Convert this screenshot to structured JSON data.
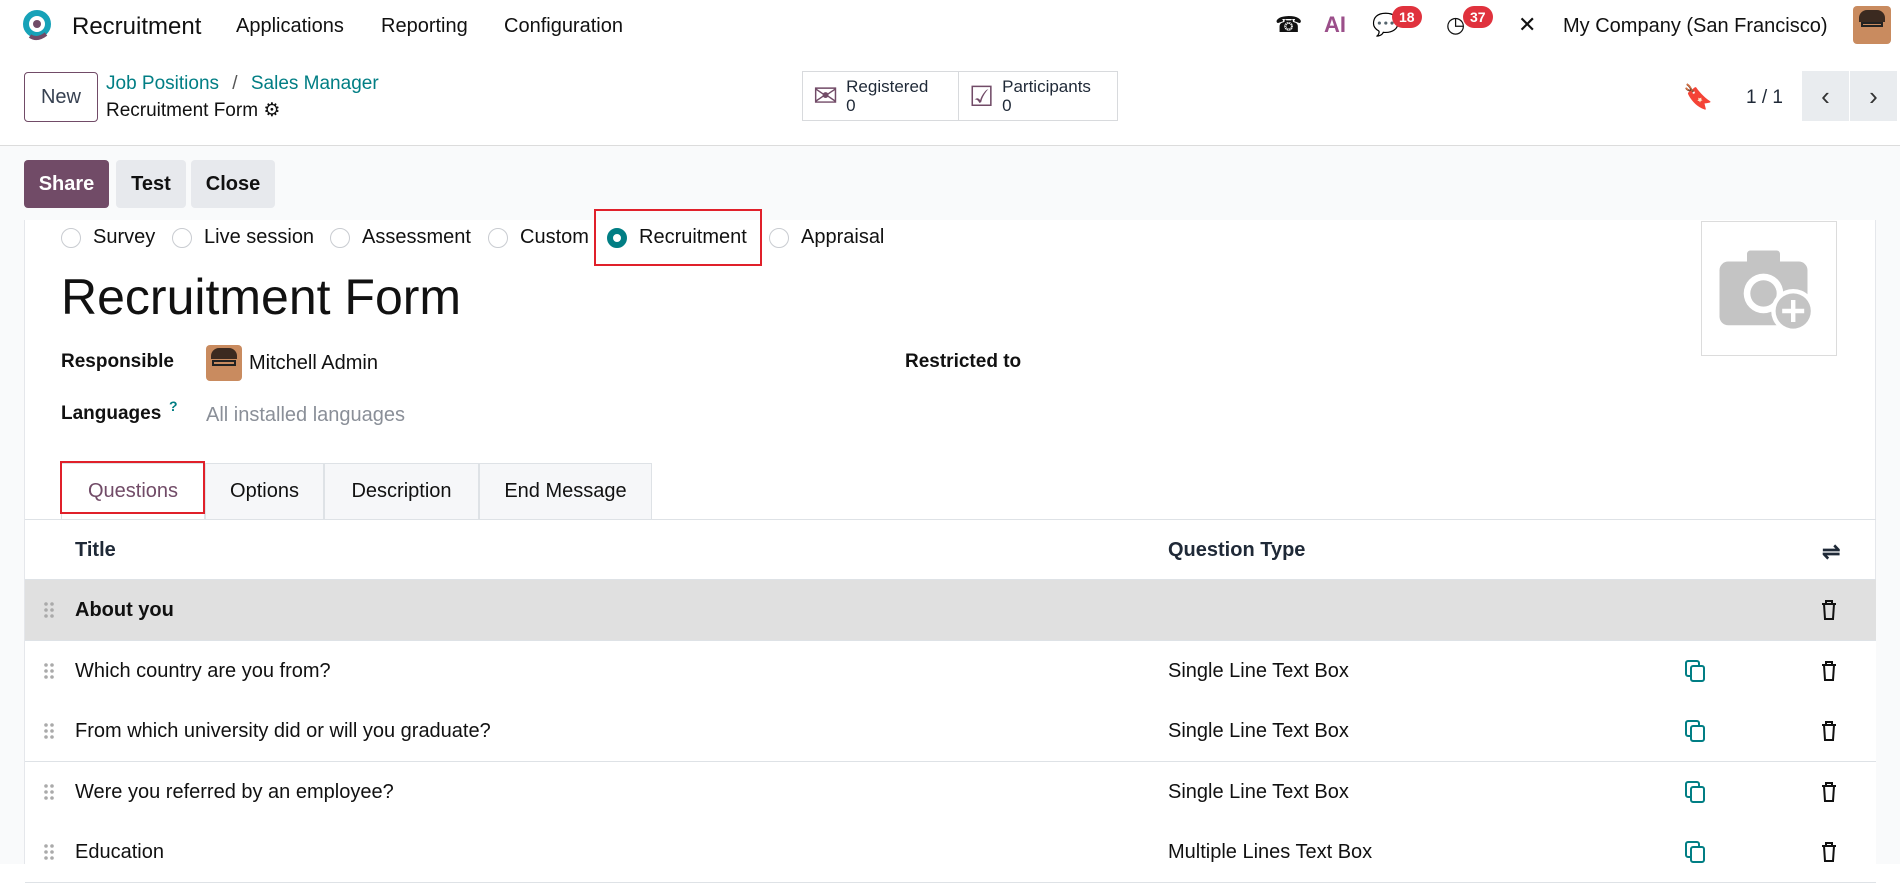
{
  "nav": {
    "app": "Recruitment",
    "menus": [
      "Applications",
      "Reporting",
      "Configuration"
    ],
    "messages_count": "18",
    "activities_count": "37",
    "ai_label": "AI",
    "company": "My Company (San Francisco)"
  },
  "control": {
    "new_label": "New",
    "breadcrumb": [
      "Job Positions",
      "Sales Manager"
    ],
    "separator": "/",
    "record": "Recruitment Form",
    "stats": [
      {
        "label": "Registered",
        "value": "0"
      },
      {
        "label": "Participants",
        "value": "0"
      }
    ],
    "pager": "1 / 1"
  },
  "actions": {
    "share": "Share",
    "test": "Test",
    "close": "Close"
  },
  "form": {
    "survey_types": [
      "Survey",
      "Live session",
      "Assessment",
      "Custom",
      "Recruitment",
      "Appraisal"
    ],
    "selected_type": "Recruitment",
    "title": "Recruitment Form",
    "responsible_label": "Responsible",
    "responsible": "Mitchell Admin",
    "restricted_label": "Restricted to",
    "languages_label": "Languages",
    "languages_help": "?",
    "languages_placeholder": "All installed languages",
    "tabs": [
      "Questions",
      "Options",
      "Description",
      "End Message"
    ],
    "active_tab": "Questions"
  },
  "table": {
    "columns": [
      "Title",
      "Question Type"
    ],
    "rows": [
      {
        "title": "About you",
        "type": "",
        "section": true
      },
      {
        "title": "Which country are you from?",
        "type": "Single Line Text Box"
      },
      {
        "title": "From which university did or will you graduate?",
        "type": "Single Line Text Box"
      },
      {
        "title": "Were you referred by an employee?",
        "type": "Single Line Text Box"
      },
      {
        "title": "Education",
        "type": "Multiple Lines Text Box"
      }
    ]
  },
  "colors": {
    "brand": "#714b67",
    "link": "#017e84",
    "highlight": "#e0202a",
    "badge": "#e0323d"
  }
}
